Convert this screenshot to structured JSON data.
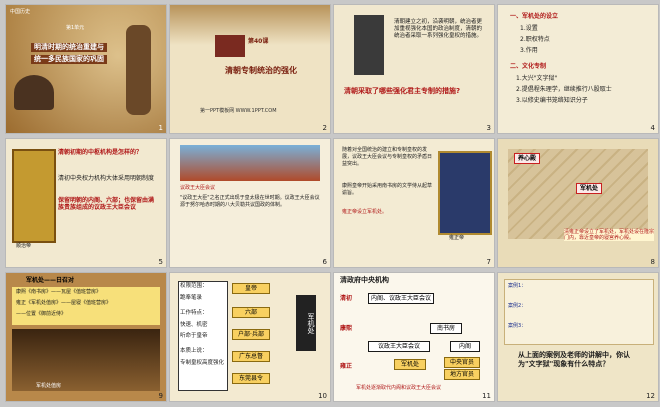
{
  "slides": [
    {
      "num": "1",
      "lines": [
        "明清时期的统治重建与",
        "统一多民族国家的巩固"
      ],
      "tag1": "中国历史",
      "tag2": "第1单元"
    },
    {
      "num": "2",
      "title1": "第40课",
      "title2": "清朝专制统治的强化",
      "footer": "第一PPT模板网 WWW.1PPT.COM"
    },
    {
      "num": "3",
      "text": "清朝建立之初，沿袭明朝，统治者更加重视强化本国的政治制度，清朝的统治者采取一系列强化皇权的措施。",
      "banner": "清朝采取了哪些强化君主专制的措施?"
    },
    {
      "num": "4",
      "h1": "一、军机处的设立",
      "items1": [
        "1.设置",
        "2.职权特点",
        "3.作用"
      ],
      "h2": "二、文化专制",
      "items2": [
        "1.大兴\"文字狱\"",
        "2.提倡程朱理学，继续推行八股取士",
        "3.以修史编书笼络知识分子"
      ]
    },
    {
      "num": "5",
      "q": "清朝初期的中枢机构是怎样的？",
      "a": "清初中央权力机构大体采用明朝制度",
      "b": "保留明朝的内阁、六部；也保留由满族贵族组成的议政王大臣会议",
      "caption": "顺治帝"
    },
    {
      "num": "6",
      "text": "议政王大臣会议",
      "para": "\"议政王大臣\"之名正式出现于皇太极在世时期。议政王大臣会议源于努尔哈赤时期的八大贝勒共议国政的体制。"
    },
    {
      "num": "7",
      "text": "随着对全国统治的建立和专制皇权的发展，议政王大臣会议与专制皇权的矛盾日益突出。",
      "b": "康熙皇帝开始采用南书房的文学侍从起草谕旨。",
      "c": "雍正帝设立军机处。",
      "caption": "雍正帝"
    },
    {
      "num": "8",
      "t1": "养心殿",
      "t2": "军机处",
      "cap": "清雍正帝设立了军机处，军机处设在隆宗门内，靠近皇帝的寝宫养心殿。"
    },
    {
      "num": "9",
      "h": "军机处——日召对",
      "r1": "康熙《南书房》——瓦屋《值班营房》",
      "r2": "雍正《军机处值房》——屋寝《值班营房》",
      "r3": "——位置《御前近侍》",
      "cap": "军机处值房"
    },
    {
      "num": "10",
      "l1": "权限范围：",
      "l2": "跪奉笔录",
      "l3": "工作特点：",
      "l4": "快速、机密",
      "l5": "听命于皇帝",
      "l6": "本质上说：",
      "l7": "专制皇权高度强化",
      "b1": "皇帝",
      "b2": "六部",
      "b3": "户部·兵部",
      "b4": "广东总督",
      "b5": "东莞县令",
      "side": "军机处"
    },
    {
      "num": "11",
      "title": "清政府中央机构",
      "k1": "清初",
      "k2": "康熙",
      "k3": "雍正",
      "n1": "内阁、议政王大臣会议",
      "n2": "南书房",
      "n3": "议政王大臣会议",
      "n4": "内阁",
      "n5": "军机处",
      "n6": "中央官员",
      "n7": "地方官员",
      "foot": "军机处逐渐取代内阁和议政王大臣会议"
    },
    {
      "num": "12",
      "q": "从上面的案例及老师的讲解中，你认为\"文字狱\"现象有什么特点？",
      "c1": "案例1：",
      "c2": "案例2：",
      "c3": "案例3："
    }
  ]
}
